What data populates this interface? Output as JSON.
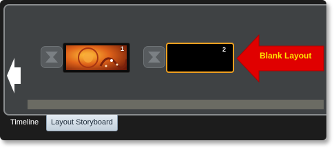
{
  "clips": [
    {
      "number": "1",
      "selected": false
    },
    {
      "number": "2",
      "selected": true
    }
  ],
  "callout": {
    "text": "Blank Layout",
    "color": "#e00000",
    "text_color": "#ffe400"
  },
  "tabs": [
    {
      "label": "Timeline",
      "active": false
    },
    {
      "label": "Layout Storyboard",
      "active": true
    }
  ],
  "icons": {
    "transition": "hourglass-transition-icon",
    "scroll_left": "left-arrow-icon"
  },
  "colors": {
    "selected_border": "#f0a020",
    "panel_background": "#3f4244"
  }
}
